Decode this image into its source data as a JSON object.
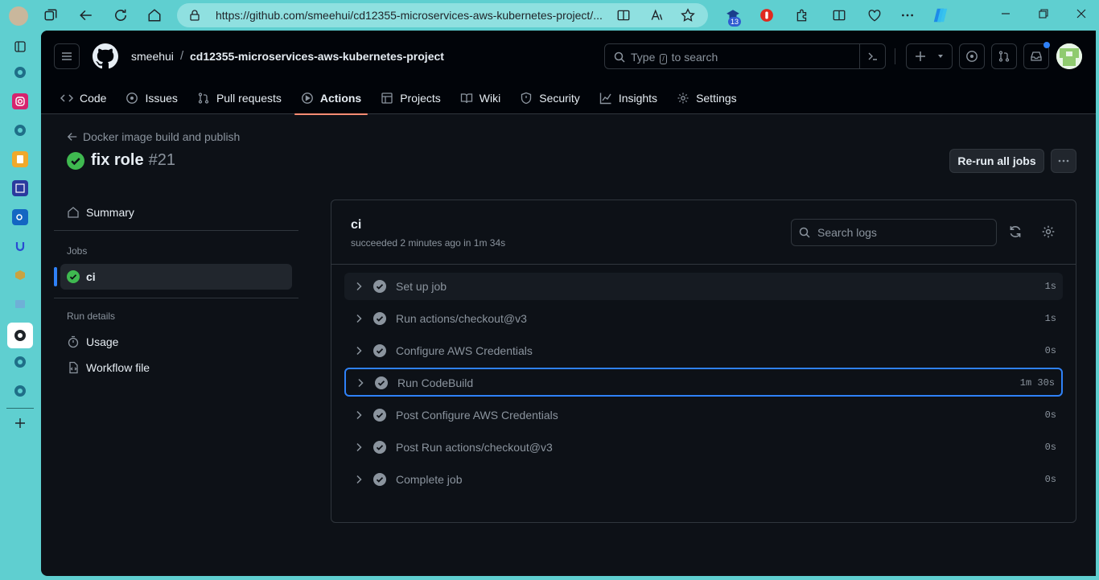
{
  "browser": {
    "url": "https://github.com/smeehui/cd12355-microservices-aws-kubernetes-project/...",
    "badge_count": "13"
  },
  "header": {
    "owner": "smeehui",
    "separator": "/",
    "repo": "cd12355-microservices-aws-kubernetes-project",
    "search_prefix": "Type",
    "search_key": "/",
    "search_suffix": "to search"
  },
  "tabs": [
    {
      "label": "Code",
      "icon": "code-icon"
    },
    {
      "label": "Issues",
      "icon": "issue-icon"
    },
    {
      "label": "Pull requests",
      "icon": "pull-request-icon"
    },
    {
      "label": "Actions",
      "icon": "play-icon"
    },
    {
      "label": "Projects",
      "icon": "table-icon"
    },
    {
      "label": "Wiki",
      "icon": "book-icon"
    },
    {
      "label": "Security",
      "icon": "shield-icon"
    },
    {
      "label": "Insights",
      "icon": "graph-icon"
    },
    {
      "label": "Settings",
      "icon": "gear-icon"
    }
  ],
  "run": {
    "workflow": "Docker image build and publish",
    "title": "fix role",
    "number": "#21",
    "rerun_label": "Re-run all jobs"
  },
  "nav": {
    "summary": "Summary",
    "jobs_heading": "Jobs",
    "job": "ci",
    "run_details_heading": "Run details",
    "usage": "Usage",
    "workflow_file": "Workflow file"
  },
  "job": {
    "name": "ci",
    "status": "succeeded 2 minutes ago in 1m 34s",
    "search_placeholder": "Search logs",
    "steps": [
      {
        "label": "Set up job",
        "duration": "1s"
      },
      {
        "label": "Run actions/checkout@v3",
        "duration": "1s"
      },
      {
        "label": "Configure AWS Credentials",
        "duration": "0s"
      },
      {
        "label": "Run CodeBuild",
        "duration": "1m 30s"
      },
      {
        "label": "Post Configure AWS Credentials",
        "duration": "0s"
      },
      {
        "label": "Post Run actions/checkout@v3",
        "duration": "0s"
      },
      {
        "label": "Complete job",
        "duration": "0s"
      }
    ]
  },
  "colors": {
    "success": "#3fb950",
    "accent": "#2f81f7",
    "tab_underline": "#fd8c73"
  }
}
